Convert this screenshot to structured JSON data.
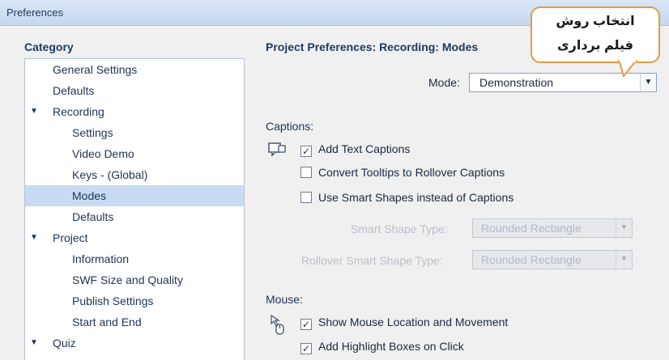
{
  "window": {
    "title": "Preferences"
  },
  "category": {
    "header": "Category",
    "items": [
      {
        "label": "General Settings",
        "level": 1,
        "expander": ""
      },
      {
        "label": "Defaults",
        "level": 1,
        "expander": ""
      },
      {
        "label": "Recording",
        "level": 1,
        "expander": "▼"
      },
      {
        "label": "Settings",
        "level": 2,
        "expander": ""
      },
      {
        "label": "Video Demo",
        "level": 2,
        "expander": ""
      },
      {
        "label": "Keys - (Global)",
        "level": 2,
        "expander": ""
      },
      {
        "label": "Modes",
        "level": 2,
        "expander": "",
        "selected": true
      },
      {
        "label": "Defaults",
        "level": 2,
        "expander": ""
      },
      {
        "label": "Project",
        "level": 1,
        "expander": "▼"
      },
      {
        "label": "Information",
        "level": 2,
        "expander": ""
      },
      {
        "label": "SWF Size and Quality",
        "level": 2,
        "expander": ""
      },
      {
        "label": "Publish Settings",
        "level": 2,
        "expander": ""
      },
      {
        "label": "Start and End",
        "level": 2,
        "expander": ""
      },
      {
        "label": "Quiz",
        "level": 1,
        "expander": "▼"
      }
    ]
  },
  "main": {
    "title": "Project Preferences: Recording: Modes",
    "mode": {
      "label": "Mode:",
      "value": "Demonstration",
      "arrow": "▼"
    },
    "captions": {
      "header": "Captions:",
      "add_text_captions": {
        "label": "Add Text Captions",
        "checked": true,
        "mark": "✓"
      },
      "convert_tooltips": {
        "label": "Convert Tooltips to Rollover Captions",
        "checked": false,
        "mark": ""
      },
      "use_smart_shapes": {
        "label": "Use Smart Shapes instead of Captions",
        "checked": false,
        "mark": ""
      },
      "smart_shape_type": {
        "label": "Smart Shape Type:",
        "value": "Rounded Rectangle",
        "arrow": "▼",
        "enabled": false
      },
      "rollover_shape_type": {
        "label": "Rollover Smart Shape Type:",
        "value": "Rounded Rectangle",
        "arrow": "▼",
        "enabled": false
      }
    },
    "mouse": {
      "header": "Mouse:",
      "show_mouse_location": {
        "label": "Show Mouse Location and Movement",
        "checked": true,
        "mark": "✓"
      },
      "add_highlight_boxes": {
        "label": "Add Highlight Boxes on Click",
        "checked": true,
        "mark": "✓"
      }
    }
  },
  "callout": {
    "line1": "انتخاب روش",
    "line2": "فیلم برداری",
    "border_color": "#e39b47"
  },
  "colors": {
    "selection": "#c8dbf2",
    "titlebar": "#c5d8ee",
    "disabled_text": "#b9c0c9"
  }
}
